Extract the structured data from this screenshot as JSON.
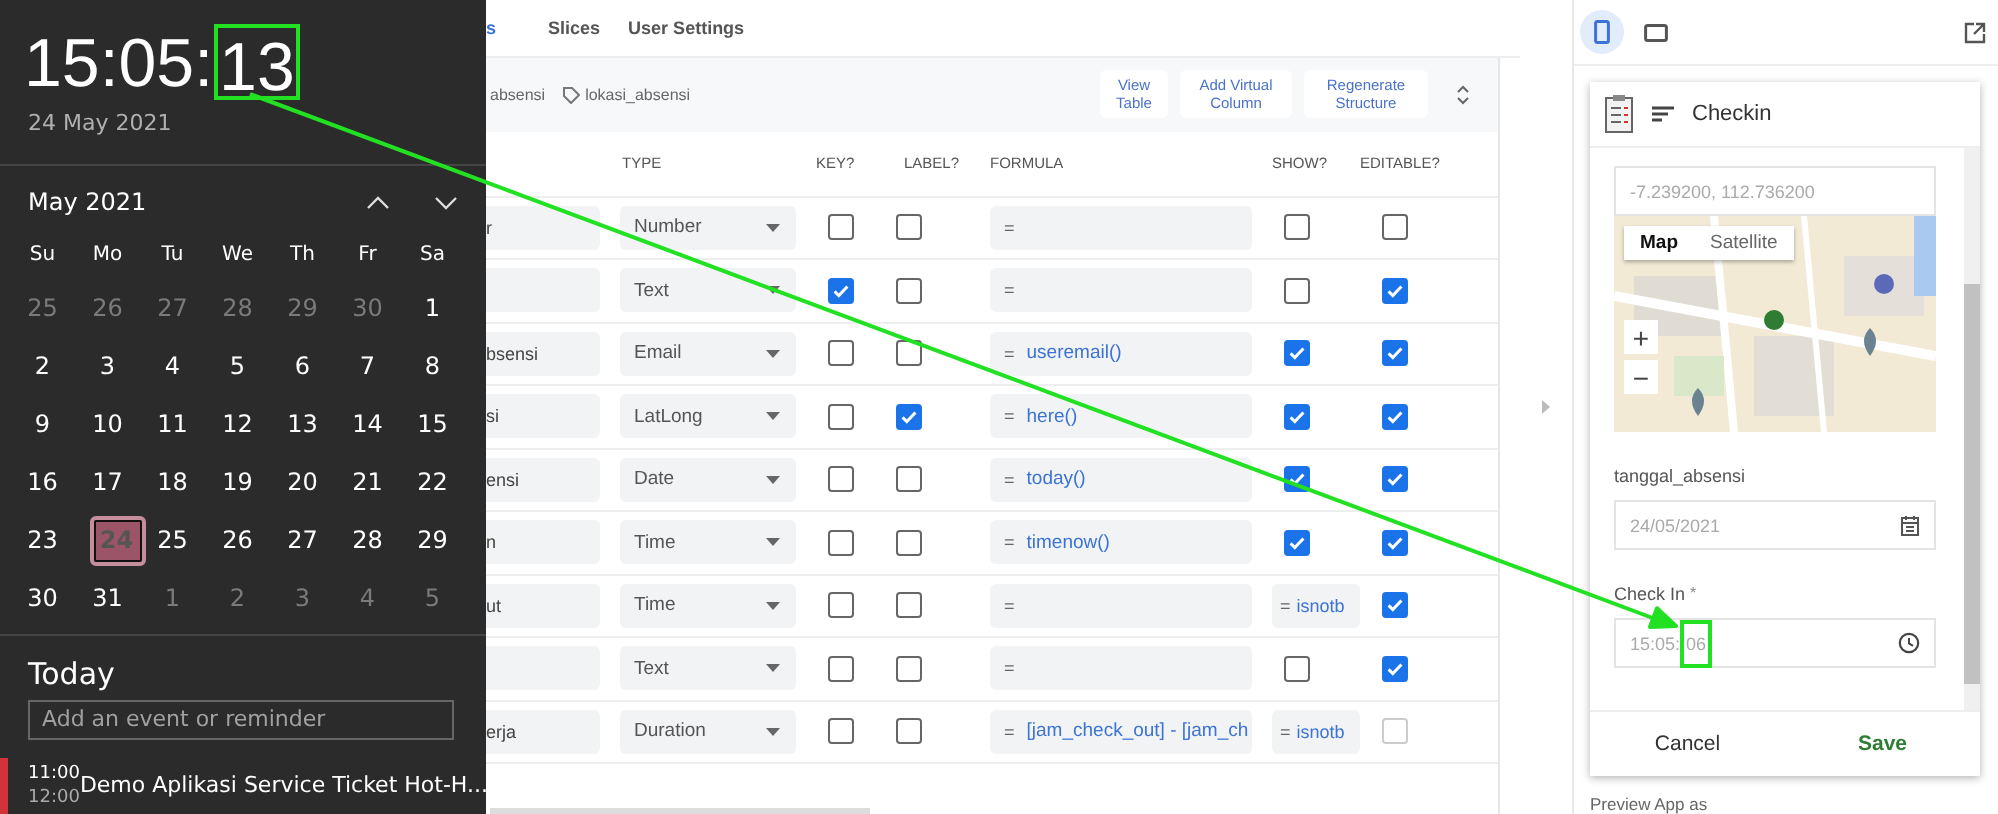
{
  "clock": {
    "hours_minutes": "15:05",
    "separator": ":",
    "seconds": "13",
    "date": "24 May 2021"
  },
  "calendar": {
    "month": "May 2021",
    "weekdays": [
      "Su",
      "Mo",
      "Tu",
      "We",
      "Th",
      "Fr",
      "Sa"
    ],
    "weeks": [
      [
        {
          "day": "25",
          "other_month": true,
          "selected": false
        },
        {
          "day": "26",
          "other_month": true,
          "selected": false
        },
        {
          "day": "27",
          "other_month": true,
          "selected": false
        },
        {
          "day": "28",
          "other_month": true,
          "selected": false
        },
        {
          "day": "29",
          "other_month": true,
          "selected": false
        },
        {
          "day": "30",
          "other_month": true,
          "selected": false
        },
        {
          "day": "1",
          "other_month": false,
          "selected": false
        }
      ],
      [
        {
          "day": "2",
          "other_month": false,
          "selected": false
        },
        {
          "day": "3",
          "other_month": false,
          "selected": false
        },
        {
          "day": "4",
          "other_month": false,
          "selected": false
        },
        {
          "day": "5",
          "other_month": false,
          "selected": false
        },
        {
          "day": "6",
          "other_month": false,
          "selected": false
        },
        {
          "day": "7",
          "other_month": false,
          "selected": false
        },
        {
          "day": "8",
          "other_month": false,
          "selected": false
        }
      ],
      [
        {
          "day": "9",
          "other_month": false,
          "selected": false
        },
        {
          "day": "10",
          "other_month": false,
          "selected": false
        },
        {
          "day": "11",
          "other_month": false,
          "selected": false
        },
        {
          "day": "12",
          "other_month": false,
          "selected": false
        },
        {
          "day": "13",
          "other_month": false,
          "selected": false
        },
        {
          "day": "14",
          "other_month": false,
          "selected": false
        },
        {
          "day": "15",
          "other_month": false,
          "selected": false
        }
      ],
      [
        {
          "day": "16",
          "other_month": false,
          "selected": false
        },
        {
          "day": "17",
          "other_month": false,
          "selected": false
        },
        {
          "day": "18",
          "other_month": false,
          "selected": false
        },
        {
          "day": "19",
          "other_month": false,
          "selected": false
        },
        {
          "day": "20",
          "other_month": false,
          "selected": false
        },
        {
          "day": "21",
          "other_month": false,
          "selected": false
        },
        {
          "day": "22",
          "other_month": false,
          "selected": false
        }
      ],
      [
        {
          "day": "23",
          "other_month": false,
          "selected": false
        },
        {
          "day": "24",
          "other_month": false,
          "selected": true
        },
        {
          "day": "25",
          "other_month": false,
          "selected": false
        },
        {
          "day": "26",
          "other_month": false,
          "selected": false
        },
        {
          "day": "27",
          "other_month": false,
          "selected": false
        },
        {
          "day": "28",
          "other_month": false,
          "selected": false
        },
        {
          "day": "29",
          "other_month": false,
          "selected": false
        }
      ],
      [
        {
          "day": "30",
          "other_month": false,
          "selected": false
        },
        {
          "day": "31",
          "other_month": false,
          "selected": false
        },
        {
          "day": "1",
          "other_month": true,
          "selected": false
        },
        {
          "day": "2",
          "other_month": true,
          "selected": false
        },
        {
          "day": "3",
          "other_month": true,
          "selected": false
        },
        {
          "day": "4",
          "other_month": true,
          "selected": false
        },
        {
          "day": "5",
          "other_month": true,
          "selected": false
        }
      ]
    ]
  },
  "agenda": {
    "heading": "Today",
    "input": {
      "placeholder": "Add an event or reminder"
    },
    "events": [
      {
        "start": "11:00",
        "end": "12:00",
        "title": "Demo Aplikasi Service Ticket Hot-H..."
      }
    ]
  },
  "editor": {
    "tabs": [
      {
        "label": "s",
        "selected": true
      },
      {
        "label": "Slices",
        "selected": false
      },
      {
        "label": "User Settings",
        "selected": false
      }
    ],
    "header": {
      "name": "absensi",
      "tag": "lokasi_absensi",
      "buttons": [
        "View Table",
        "Add Virtual Column",
        "Regenerate Structure"
      ]
    },
    "columns": [
      "TYPE",
      "KEY?",
      "LABEL?",
      "FORMULA",
      "SHOW?",
      "EDITABLE?"
    ],
    "rows": [
      {
        "name": "r",
        "type": "Number",
        "key": false,
        "label": false,
        "formula": {
          "sign": "="
        },
        "show": {
          "kind": "checkbox",
          "checked": false
        },
        "editable": {
          "checked": false,
          "disabled": false
        }
      },
      {
        "type": "Text",
        "key": true,
        "label": false,
        "formula": {
          "sign": "="
        },
        "show": {
          "kind": "checkbox",
          "checked": false
        },
        "editable": {
          "checked": true,
          "disabled": false
        }
      },
      {
        "name": "bsensi",
        "type": "Email",
        "key": false,
        "label": false,
        "formula": {
          "sign": "=",
          "expr": "useremail()"
        },
        "show": {
          "kind": "checkbox",
          "checked": true
        },
        "editable": {
          "checked": true,
          "disabled": false
        }
      },
      {
        "name": "si",
        "type": "LatLong",
        "key": false,
        "label": true,
        "formula": {
          "sign": "=",
          "expr": "here()"
        },
        "show": {
          "kind": "checkbox",
          "checked": true
        },
        "editable": {
          "checked": true,
          "disabled": false
        }
      },
      {
        "name": "ensi",
        "type": "Date",
        "key": false,
        "label": false,
        "formula": {
          "sign": "=",
          "expr": "today()"
        },
        "show": {
          "kind": "checkbox",
          "checked": true
        },
        "editable": {
          "checked": true,
          "disabled": false
        }
      },
      {
        "name": "n",
        "type": "Time",
        "key": false,
        "label": false,
        "formula": {
          "sign": "=",
          "expr": "timenow()"
        },
        "show": {
          "kind": "checkbox",
          "checked": true
        },
        "editable": {
          "checked": true,
          "disabled": false
        }
      },
      {
        "name": "ut",
        "type": "Time",
        "key": false,
        "label": false,
        "formula": {
          "sign": "="
        },
        "show": {
          "kind": "formula",
          "sign": "=",
          "expr": "isnotb"
        },
        "editable": {
          "checked": true,
          "disabled": false
        }
      },
      {
        "type": "Text",
        "key": false,
        "label": false,
        "formula": {
          "sign": "="
        },
        "show": {
          "kind": "checkbox",
          "checked": false
        },
        "editable": {
          "checked": true,
          "disabled": false
        }
      },
      {
        "name": "erja",
        "type": "Duration",
        "key": false,
        "label": false,
        "formula": {
          "sign": "=",
          "expr": "[jam_check_out] - [jam_ch"
        },
        "show": {
          "kind": "formula",
          "sign": "=",
          "expr": "isnotb"
        },
        "editable": {
          "checked": false,
          "disabled": true
        }
      }
    ]
  },
  "preview": {
    "devices": [
      {
        "kind": "phone",
        "selected": true
      },
      {
        "kind": "tablet",
        "selected": false
      }
    ],
    "app": {
      "title": "Checkin",
      "fields": [
        {
          "kind": "location",
          "value": "-7.239200, 112.736200",
          "map_types": [
            {
              "label": "Map",
              "selected": true
            },
            {
              "label": "Satellite",
              "selected": false
            }
          ],
          "zoom_controls": [
            "+",
            "−"
          ]
        },
        {
          "kind": "date",
          "label": "tanggal_absensi",
          "value": "24/05/2021"
        },
        {
          "kind": "time",
          "label": "Check In",
          "required_mark": "*",
          "value": {
            "hours_minutes": "15:05",
            "separator": ":",
            "seconds": "06"
          }
        }
      ],
      "actions": [
        {
          "label": "Cancel",
          "kind": "cancel"
        },
        {
          "label": "Save",
          "kind": "save"
        }
      ]
    },
    "caption": "Preview App as"
  }
}
